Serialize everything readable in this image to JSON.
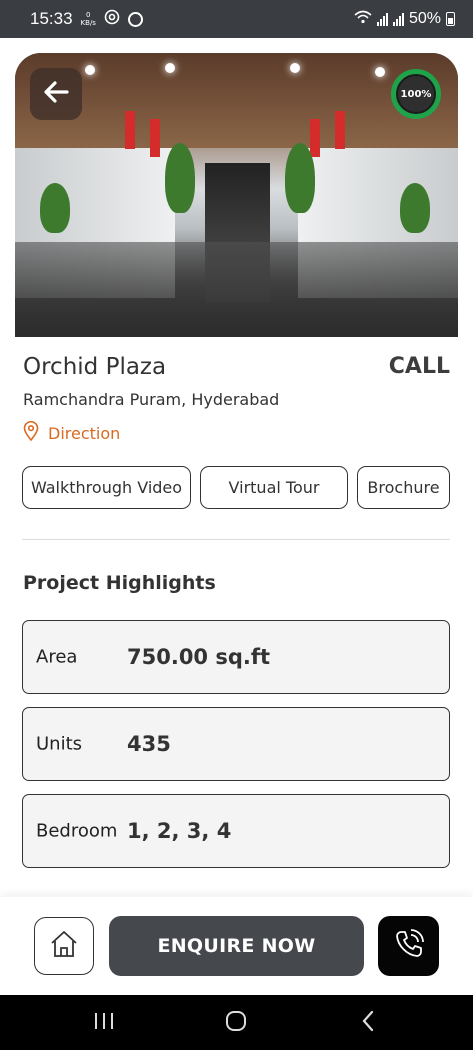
{
  "status_bar": {
    "time": "15:33",
    "net_speed_value": "0",
    "net_speed_unit": "KB/s",
    "battery_text": "50%",
    "icons": [
      "whatsapp-icon",
      "circle-icon",
      "wifi-icon",
      "signal-icon",
      "signal-icon",
      "battery-icon"
    ]
  },
  "hero": {
    "back_icon": "arrow-left-icon",
    "progress_text": "100%",
    "progress_value": 1.0,
    "progress_color": "#1ea34a"
  },
  "project": {
    "name": "Orchid Plaza",
    "call_label": "CALL",
    "address": "Ramchandra Puram, Hyderabad",
    "direction_label": "Direction",
    "direction_icon": "map-pin-icon",
    "accent_color": "#d86a22"
  },
  "media_buttons": [
    {
      "label": "Walkthrough Video"
    },
    {
      "label": "Virtual Tour"
    },
    {
      "label": "Brochure"
    }
  ],
  "highlights": {
    "title": "Project Highlights",
    "items": [
      {
        "label": "Area",
        "value": "750.00 sq.ft"
      },
      {
        "label": "Units",
        "value": "435"
      },
      {
        "label": "Bedroom",
        "value": "1, 2, 3, 4"
      }
    ]
  },
  "actions": {
    "home_icon": "home-icon",
    "enquire_label": "ENQUIRE NOW",
    "phone_icon": "phone-icon"
  },
  "system_nav": {
    "icons": [
      "recent-apps-icon",
      "home-circle-icon",
      "back-chevron-icon"
    ]
  }
}
